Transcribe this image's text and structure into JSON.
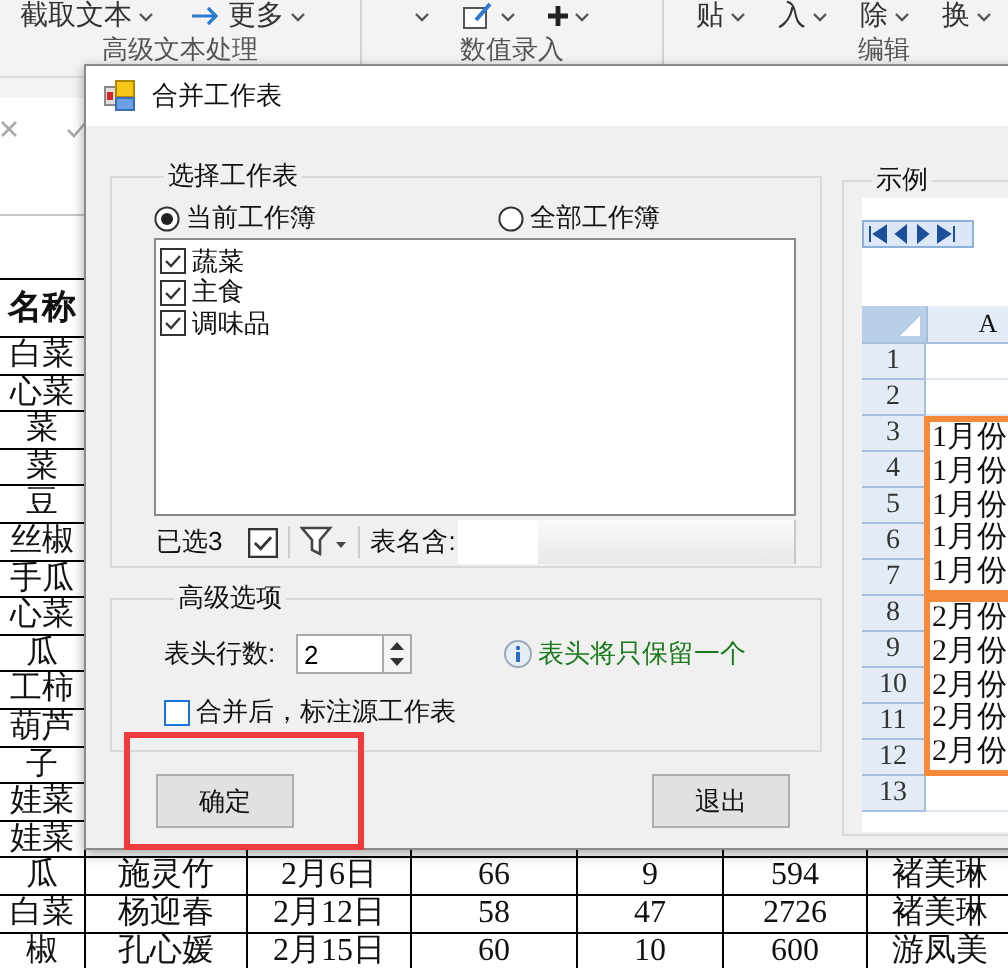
{
  "ribbon": {
    "groups": [
      {
        "label": "高级文本处理",
        "items": [
          {
            "kind": "menu",
            "label": "截取文本"
          },
          {
            "kind": "arrow-menu",
            "label": "更多"
          }
        ]
      },
      {
        "label": "数值录入",
        "items": [
          {
            "kind": "caret"
          },
          {
            "kind": "table-menu"
          },
          {
            "kind": "plus-menu"
          }
        ]
      },
      {
        "label": "编辑",
        "items": [
          {
            "kind": "menu",
            "label": "贴"
          },
          {
            "kind": "menu",
            "label": "入"
          },
          {
            "kind": "menu",
            "label": "除"
          },
          {
            "kind": "menu",
            "label": "换"
          }
        ]
      }
    ]
  },
  "sheet": {
    "column_1": [
      "名称",
      "白菜",
      "心菜",
      "菜",
      "菜",
      "豆",
      "丝椒",
      "手瓜",
      "心菜",
      "瓜",
      "工柿",
      "葫芦",
      "子",
      "娃菜",
      "娃菜"
    ],
    "rows": [
      [
        "瓜",
        "施灵竹",
        "2月6日",
        "66",
        "9",
        "594",
        "褚美琳"
      ],
      [
        "白菜",
        "杨迎春",
        "2月12日",
        "58",
        "47",
        "2726",
        "褚美琳"
      ],
      [
        "椒",
        "孔心媛",
        "2月15日",
        "60",
        "10",
        "600",
        "游凤美"
      ]
    ]
  },
  "dialog": {
    "title": "合并工作表",
    "select_group": {
      "label": "选择工作表",
      "scope": [
        {
          "label": "当前工作簿",
          "selected": true
        },
        {
          "label": "全部工作簿",
          "selected": false
        }
      ],
      "sheets": [
        {
          "label": "蔬菜",
          "checked": true
        },
        {
          "label": "主食",
          "checked": true
        },
        {
          "label": "调味品",
          "checked": true
        }
      ],
      "selected_count": "已选3",
      "select_all_checked": true,
      "name_filter_label": "表名含:"
    },
    "advanced": {
      "label": "高级选项",
      "header_rows_label": "表头行数:",
      "header_rows": "2",
      "hint": "表头将只保留一个",
      "mark_source": {
        "label": "合并后，标注源工作表",
        "checked": false
      }
    },
    "buttons": [
      "确定",
      "退出"
    ],
    "example": {
      "label": "示例",
      "column": "A",
      "blocks": [
        {
          "highlighted": false,
          "rows": [
            {
              "number": "1"
            },
            {
              "number": "2"
            }
          ]
        },
        {
          "highlighted": true,
          "rows": [
            {
              "number": "3",
              "value": "1月份"
            },
            {
              "number": "4",
              "value": "1月份"
            },
            {
              "number": "5",
              "value": "1月份"
            },
            {
              "number": "6",
              "value": "1月份"
            },
            {
              "number": "7",
              "value": "1月份"
            }
          ]
        },
        {
          "highlighted": true,
          "rows": [
            {
              "number": "8",
              "value": "2月份"
            },
            {
              "number": "9",
              "value": "2月份"
            },
            {
              "number": "10",
              "value": "2月份"
            },
            {
              "number": "11",
              "value": "2月份"
            },
            {
              "number": "12",
              "value": "2月份"
            }
          ]
        },
        {
          "highlighted": false,
          "rows": [
            {
              "number": "13"
            }
          ]
        }
      ]
    }
  }
}
